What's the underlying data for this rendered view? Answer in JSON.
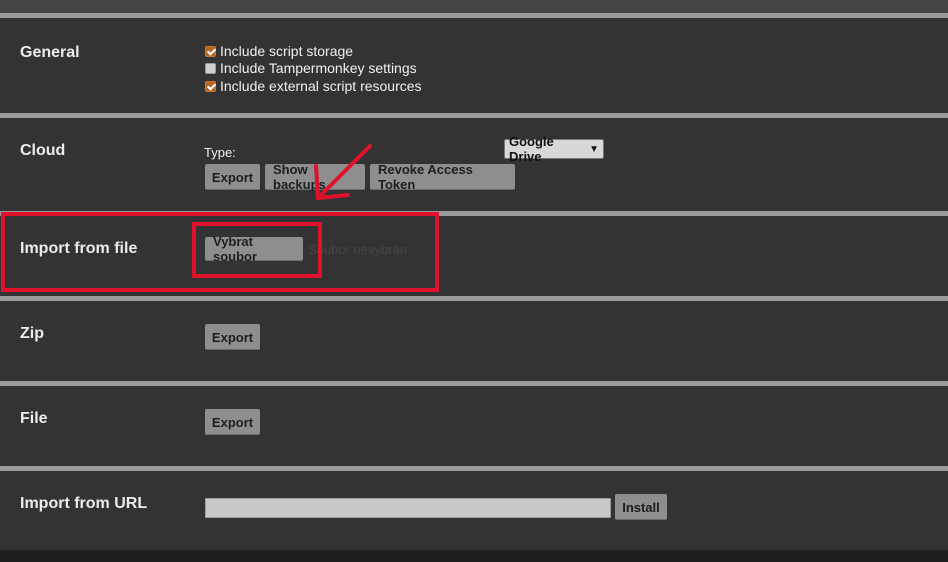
{
  "general": {
    "title": "General",
    "options": [
      {
        "label": "Include script storage",
        "checked": true
      },
      {
        "label": "Include Tampermonkey settings",
        "checked": false
      },
      {
        "label": "Include external script resources",
        "checked": true
      }
    ]
  },
  "cloud": {
    "title": "Cloud",
    "type_label": "Type:",
    "type_selected": "Google Drive",
    "buttons": {
      "export": "Export",
      "show_backups": "Show backups",
      "revoke": "Revoke Access Token"
    }
  },
  "import_file": {
    "title": "Import from file",
    "choose_button": "Vybrat soubor",
    "status": "Soubor nevybrán"
  },
  "zip": {
    "title": "Zip",
    "export_button": "Export"
  },
  "file": {
    "title": "File",
    "export_button": "Export"
  },
  "import_url": {
    "title": "Import from URL",
    "url_value": "",
    "install_button": "Install"
  },
  "colors": {
    "section_bg": "#333333",
    "divider": "#9a9a9a",
    "button_bg": "#8e8e8e",
    "annotation_red": "#e0112b",
    "checkbox_checked": "#b8651c"
  }
}
